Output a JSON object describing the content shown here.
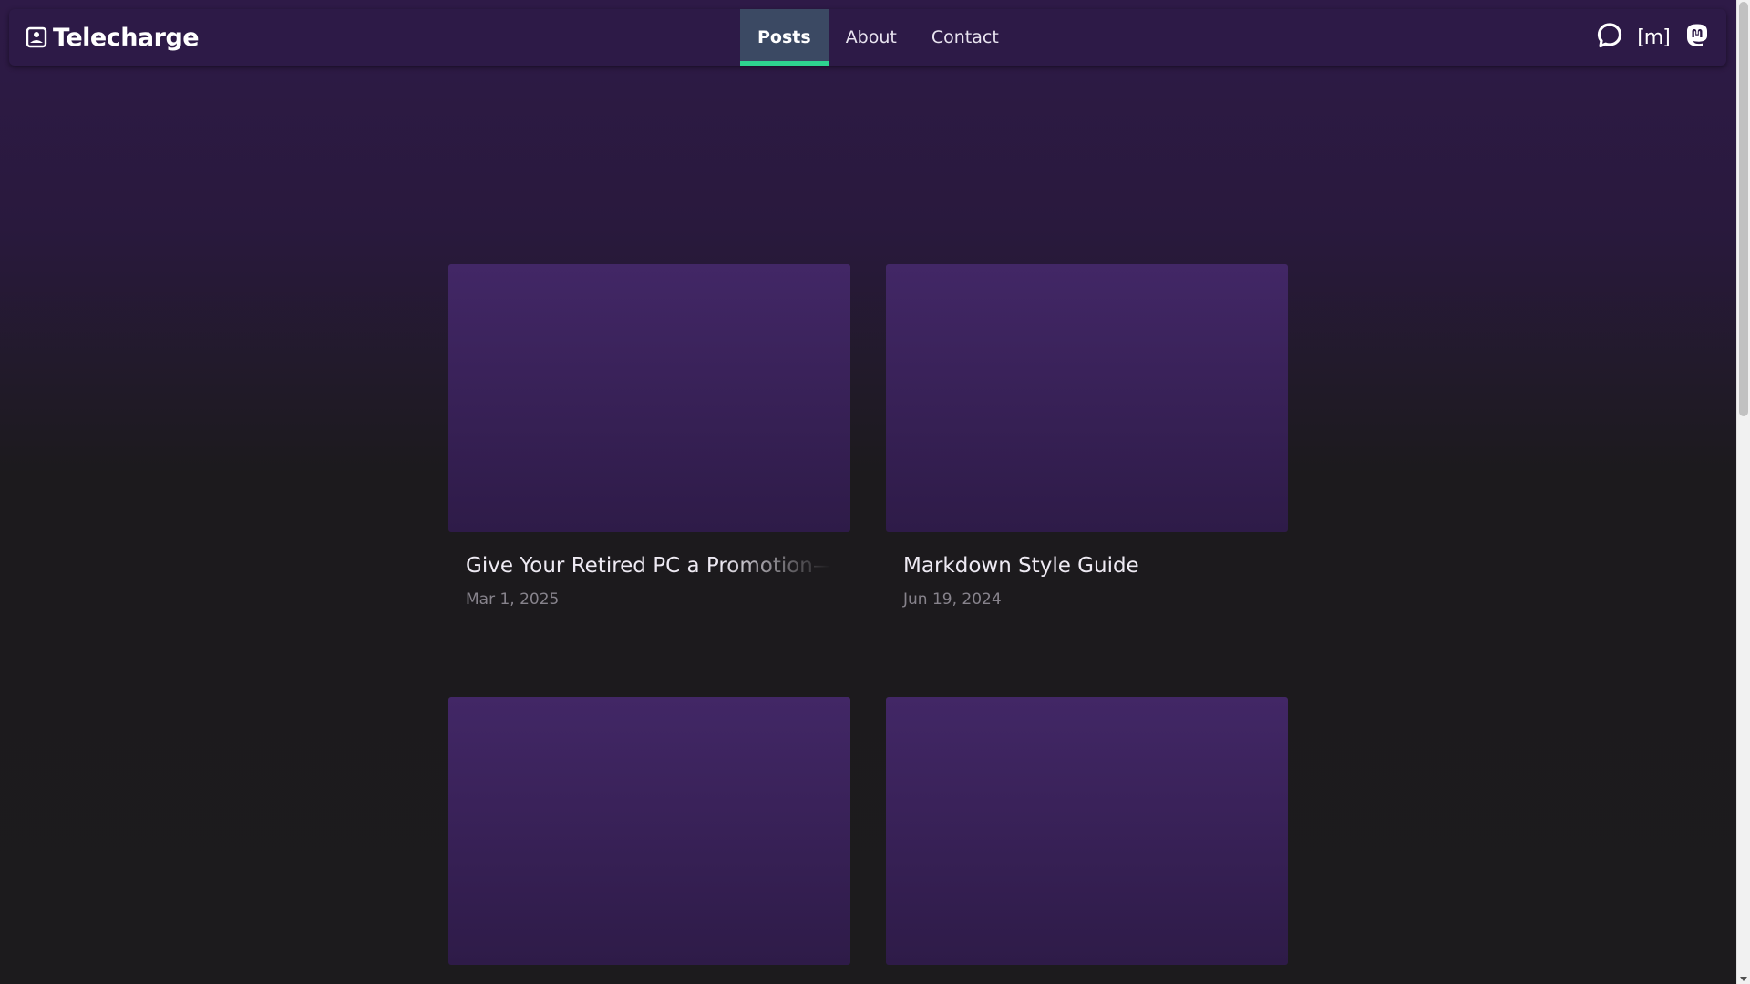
{
  "nav": {
    "brand": "Telecharge",
    "brand_icon": "photo-frame-icon",
    "links": [
      {
        "label": "Posts",
        "active": true
      },
      {
        "label": "About",
        "active": false
      },
      {
        "label": "Contact",
        "active": false
      }
    ],
    "social": [
      {
        "icon": "chat-bubble-icon"
      },
      {
        "icon": "matrix-icon",
        "glyph": "[m]"
      },
      {
        "icon": "mastodon-icon"
      }
    ]
  },
  "posts": [
    {
      "title": "Give Your Retired PC a Promotion—",
      "date": "Mar 1, 2025"
    },
    {
      "title": "Markdown Style Guide",
      "date": "Jun 19, 2024"
    },
    {
      "title": "",
      "date": ""
    },
    {
      "title": "",
      "date": ""
    }
  ],
  "colors": {
    "nav_bg": "#2d1a47",
    "active_tab_bg": "#3b4963",
    "active_indicator": "#2ed38f",
    "card_top": "#422766",
    "card_bottom": "#2e1b48",
    "page_bottom": "#1c1b1d"
  }
}
